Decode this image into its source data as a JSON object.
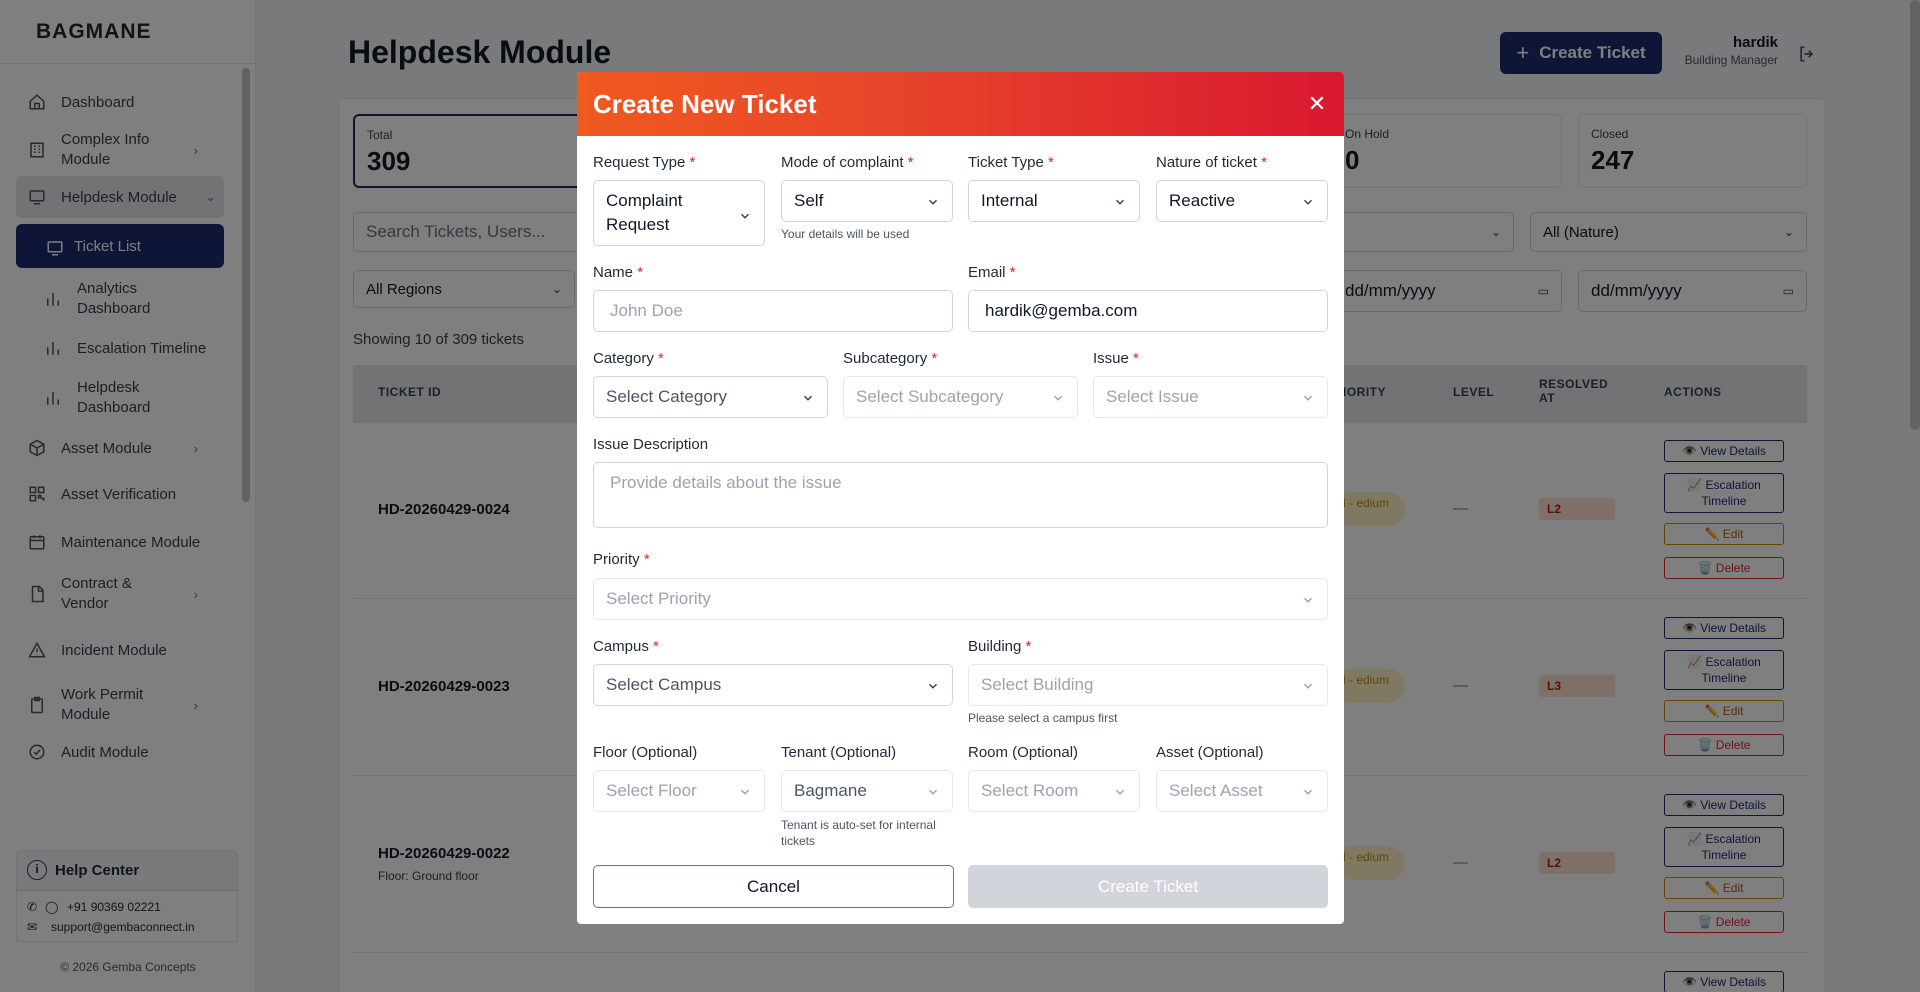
{
  "brand": "BAGMANE",
  "sidebar": {
    "items": [
      {
        "label": "Dashboard"
      },
      {
        "label": "Complex Info Module"
      },
      {
        "label": "Helpdesk Module"
      },
      {
        "label": "Ticket List"
      },
      {
        "label": "Analytics Dashboard"
      },
      {
        "label": "Escalation Timeline"
      },
      {
        "label": "Helpdesk Dashboard"
      },
      {
        "label": "Asset Module"
      },
      {
        "label": "Asset Verification"
      },
      {
        "label": "Maintenance Module"
      },
      {
        "label": "Contract & Vendor"
      },
      {
        "label": "Incident Module"
      },
      {
        "label": "Work Permit Module"
      },
      {
        "label": "Audit Module"
      }
    ],
    "help": "Help Center",
    "phone": "+91 90369 02221",
    "email": "support@gembaconnect.in",
    "copyright": "© 2026 Gemba Concepts"
  },
  "header": {
    "title": "Helpdesk Module",
    "create_button": "Create Ticket",
    "user_name": "hardik",
    "user_role": "Building Manager"
  },
  "stats": [
    {
      "label": "Total",
      "value": "309"
    },
    {
      "label": "On Hold",
      "value": "0"
    },
    {
      "label": "Closed",
      "value": "247"
    }
  ],
  "filters": {
    "search_placeholder": "Search Tickets, Users...",
    "nature": "All (Nature)",
    "regions": "All Regions",
    "date_from": "dd/mm/yyyy",
    "date_to": "dd/mm/yyyy"
  },
  "showing": "Showing 10 of 309 tickets",
  "table": {
    "headers": [
      "TICKET ID",
      "IORITY",
      "LEVEL",
      "RESOLVED AT",
      "ACTIONS"
    ],
    "rows": [
      {
        "id": "HD-20260429-0024",
        "sub": "",
        "priority": "l - edium",
        "level": "L2",
        "resolved": "—"
      },
      {
        "id": "HD-20260429-0023",
        "sub": "",
        "priority": "l - edium",
        "level": "L3",
        "resolved": "—"
      },
      {
        "id": "HD-20260429-0022",
        "sub": "Floor: Ground floor",
        "priority": "l - edium",
        "level": "L2",
        "resolved": "—"
      }
    ],
    "actions": {
      "view": "👁️ View Details",
      "escalation": "📈 Escalation Timeline",
      "edit": "✏️ Edit",
      "delete": "🗑️ Delete"
    }
  },
  "modal": {
    "title": "Create New Ticket",
    "request_type": {
      "label": "Request Type",
      "value": "Complaint Request"
    },
    "mode": {
      "label": "Mode of complaint",
      "value": "Self",
      "hint": "Your details will be used"
    },
    "ticket_type": {
      "label": "Ticket Type",
      "value": "Internal"
    },
    "nature": {
      "label": "Nature of ticket",
      "value": "Reactive"
    },
    "name": {
      "label": "Name",
      "placeholder": "John Doe"
    },
    "email": {
      "label": "Email",
      "value": "hardik@gemba.com"
    },
    "category": {
      "label": "Category",
      "placeholder": "Select Category"
    },
    "subcategory": {
      "label": "Subcategory",
      "placeholder": "Select Subcategory"
    },
    "issue": {
      "label": "Issue",
      "placeholder": "Select Issue"
    },
    "description": {
      "label": "Issue Description",
      "placeholder": "Provide details about the issue"
    },
    "priority": {
      "label": "Priority",
      "placeholder": "Select Priority"
    },
    "campus": {
      "label": "Campus",
      "placeholder": "Select Campus"
    },
    "building": {
      "label": "Building",
      "placeholder": "Select Building",
      "hint": "Please select a campus first"
    },
    "floor": {
      "label": "Floor (Optional)",
      "placeholder": "Select Floor"
    },
    "tenant": {
      "label": "Tenant (Optional)",
      "value": "Bagmane",
      "hint": "Tenant is auto-set for internal tickets"
    },
    "room": {
      "label": "Room (Optional)",
      "placeholder": "Select Room"
    },
    "asset": {
      "label": "Asset (Optional)",
      "placeholder": "Select Asset"
    },
    "cancel": "Cancel",
    "create": "Create Ticket",
    "required_mark": "*"
  },
  "colors": {
    "brand_navy": "#1e2a6e",
    "header_gradient_start": "#ef5a1f",
    "header_gradient_end": "#d8182f",
    "required": "#dc2626"
  }
}
